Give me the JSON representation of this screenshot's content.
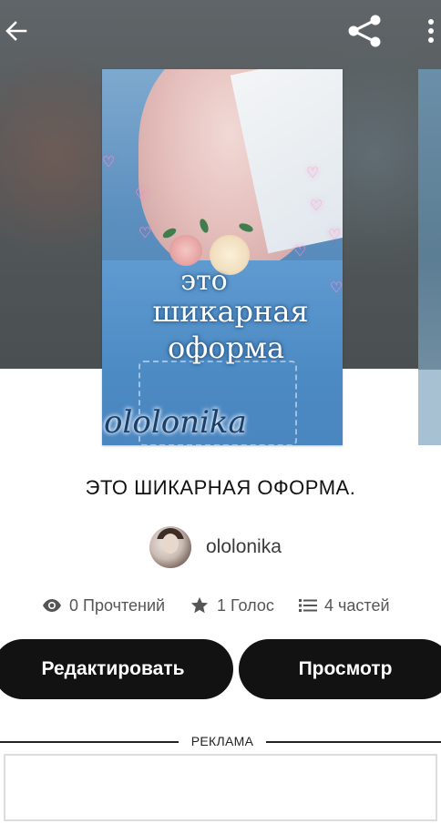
{
  "header": {
    "back_icon": "arrow-left-icon",
    "share_icon": "share-icon",
    "more_icon": "more-vertical-icon"
  },
  "cover": {
    "line1": "это",
    "line2": "шикарная",
    "line3": "оформа",
    "author": "ololonika"
  },
  "story": {
    "title": "ЭТО ШИКАРНАЯ ОФОРМА.",
    "author_name": "ololonika"
  },
  "stats": {
    "reads": "0 Прочтений",
    "votes": "1 Голос",
    "parts": "4 частей"
  },
  "buttons": {
    "edit": "Редактировать",
    "view": "Просмотр"
  },
  "ad": {
    "label": "РЕКЛАМА"
  },
  "colors": {
    "button_bg": "#121212",
    "button_text": "#ffffff",
    "header_bg": "#5a6062"
  }
}
